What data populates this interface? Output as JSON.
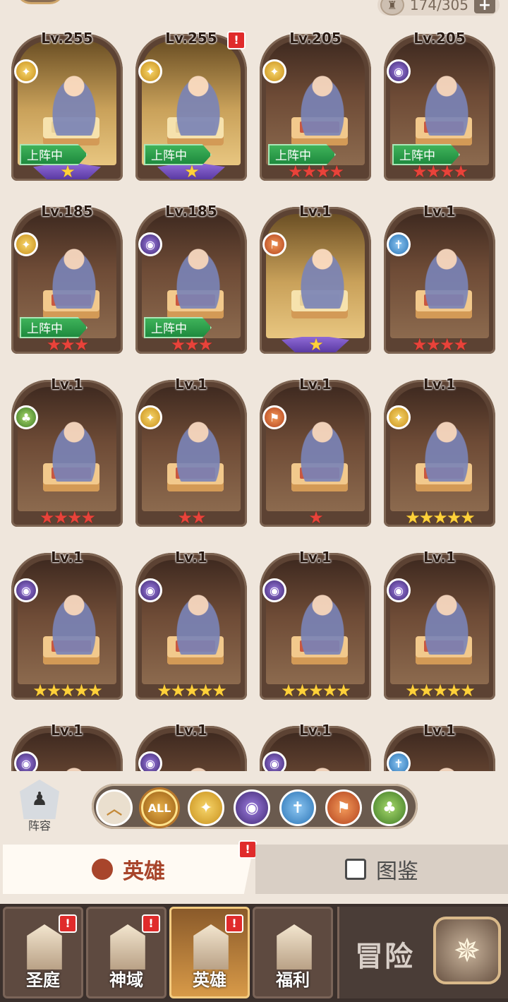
{
  "top": {
    "counter_text": "174/305",
    "plus": "+"
  },
  "heroes": [
    {
      "level": "Lv.255",
      "faction": "light",
      "deployed": true,
      "deploy_label": "上阵中",
      "stars": "★",
      "star_style": "wing",
      "bg": "gold",
      "alert": true
    },
    {
      "level": "Lv.255",
      "faction": "light",
      "deployed": true,
      "deploy_label": "上阵中",
      "stars": "★",
      "star_style": "wing",
      "bg": "gold",
      "alert": true
    },
    {
      "level": "Lv.205",
      "faction": "light",
      "deployed": true,
      "deploy_label": "上阵中",
      "stars": "★★★★",
      "star_style": "red",
      "bg": "brown",
      "alert": false
    },
    {
      "level": "Lv.205",
      "faction": "dark",
      "deployed": true,
      "deploy_label": "上阵中",
      "stars": "★★★★",
      "star_style": "red",
      "bg": "brown",
      "alert": false
    },
    {
      "level": "Lv.185",
      "faction": "light",
      "deployed": true,
      "deploy_label": "上阵中",
      "stars": "★★★",
      "star_style": "red",
      "bg": "brown",
      "alert": false
    },
    {
      "level": "Lv.185",
      "faction": "dark",
      "deployed": true,
      "deploy_label": "上阵中",
      "stars": "★★★",
      "star_style": "red",
      "bg": "brown",
      "alert": false
    },
    {
      "level": "Lv.1",
      "faction": "beast",
      "deployed": false,
      "deploy_label": "",
      "stars": "★",
      "star_style": "wing",
      "bg": "gold",
      "alert": false
    },
    {
      "level": "Lv.1",
      "faction": "holy",
      "deployed": false,
      "deploy_label": "",
      "stars": "★★★★",
      "star_style": "red",
      "bg": "brown",
      "alert": false
    },
    {
      "level": "Lv.1",
      "faction": "nature",
      "deployed": false,
      "deploy_label": "",
      "stars": "★★★★",
      "star_style": "red",
      "bg": "brown",
      "alert": false
    },
    {
      "level": "Lv.1",
      "faction": "light",
      "deployed": false,
      "deploy_label": "",
      "stars": "★★",
      "star_style": "red",
      "bg": "brown",
      "alert": false
    },
    {
      "level": "Lv.1",
      "faction": "beast",
      "deployed": false,
      "deploy_label": "",
      "stars": "★",
      "star_style": "red",
      "bg": "brown",
      "alert": false
    },
    {
      "level": "Lv.1",
      "faction": "light",
      "deployed": false,
      "deploy_label": "",
      "stars": "★★★★★",
      "star_style": "gold",
      "bg": "brown",
      "alert": false
    },
    {
      "level": "Lv.1",
      "faction": "dark",
      "deployed": false,
      "deploy_label": "",
      "stars": "★★★★★",
      "star_style": "gold",
      "bg": "brown",
      "alert": false
    },
    {
      "level": "Lv.1",
      "faction": "dark",
      "deployed": false,
      "deploy_label": "",
      "stars": "★★★★★",
      "star_style": "gold",
      "bg": "brown",
      "alert": false
    },
    {
      "level": "Lv.1",
      "faction": "dark",
      "deployed": false,
      "deploy_label": "",
      "stars": "★★★★★",
      "star_style": "gold",
      "bg": "brown",
      "alert": false
    },
    {
      "level": "Lv.1",
      "faction": "dark",
      "deployed": false,
      "deploy_label": "",
      "stars": "★★★★★",
      "star_style": "gold",
      "bg": "brown",
      "alert": false
    },
    {
      "level": "Lv.1",
      "faction": "dark",
      "deployed": false,
      "deploy_label": "",
      "stars": "",
      "star_style": "red",
      "bg": "brown",
      "alert": false
    },
    {
      "level": "Lv.1",
      "faction": "dark",
      "deployed": false,
      "deploy_label": "",
      "stars": "",
      "star_style": "red",
      "bg": "brown",
      "alert": false
    },
    {
      "level": "Lv.1",
      "faction": "dark",
      "deployed": false,
      "deploy_label": "",
      "stars": "",
      "star_style": "red",
      "bg": "brown",
      "alert": false
    },
    {
      "level": "Lv.1",
      "faction": "holy",
      "deployed": false,
      "deploy_label": "",
      "stars": "",
      "star_style": "red",
      "bg": "brown",
      "alert": false
    }
  ],
  "alert_mark": "!",
  "filters": {
    "lineup_label": "阵容",
    "all_label": "ALL",
    "buttons": [
      "up",
      "all",
      "light",
      "dark",
      "holy",
      "beast",
      "nature"
    ]
  },
  "tabs": {
    "heroes_label": "英雄",
    "codex_label": "图鉴",
    "alert": "!"
  },
  "nav": {
    "items": [
      {
        "label": "圣庭",
        "alert": "!",
        "active": false
      },
      {
        "label": "神域",
        "alert": "!",
        "active": false
      },
      {
        "label": "英雄",
        "alert": "!",
        "active": true
      },
      {
        "label": "福利",
        "alert": "",
        "active": false
      }
    ],
    "adventure_label": "冒险"
  },
  "colors": {
    "light": "#e3a92a",
    "dark": "#5b3b9a",
    "beast": "#d4602d",
    "holy": "#3a8bd0",
    "nature": "#5a9a34",
    "deploy": "#1e8a3e"
  }
}
